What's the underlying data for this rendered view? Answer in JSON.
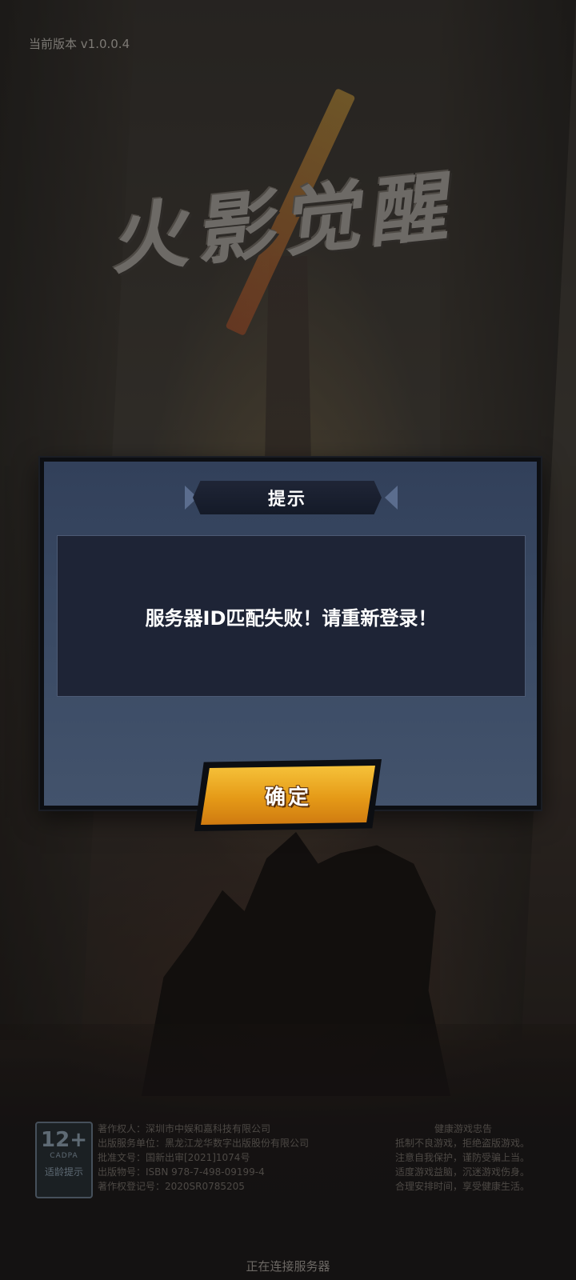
{
  "version_text": "当前版本 v1.0.0.4",
  "logo_text": "火影觉醒",
  "dialog": {
    "title": "提示",
    "message": "服务器ID匹配失败！请重新登录！",
    "confirm_label": "确定"
  },
  "rating": {
    "age": "12+",
    "org": "CADPA",
    "note": "适龄提示"
  },
  "credits": [
    "著作权人：深圳市中娱和嘉科技有限公司",
    "出版服务单位：黑龙江龙华数字出版股份有限公司",
    "批准文号：国新出审[2021]1074号",
    "出版物号：ISBN 978-7-498-09199-4",
    "著作权登记号：2020SR0785205"
  ],
  "health_notice": {
    "title": "健康游戏忠告",
    "lines": [
      "抵制不良游戏，拒绝盗版游戏。",
      "注意自我保护，谨防受骗上当。",
      "适度游戏益脑，沉迷游戏伤身。",
      "合理安排时间，享受健康生活。"
    ]
  },
  "status_text": "正在连接服务器",
  "colors": {
    "accent_button": "#e59a17",
    "dialog_bg": "#3a4a64",
    "message_bg": "#1e2436"
  }
}
